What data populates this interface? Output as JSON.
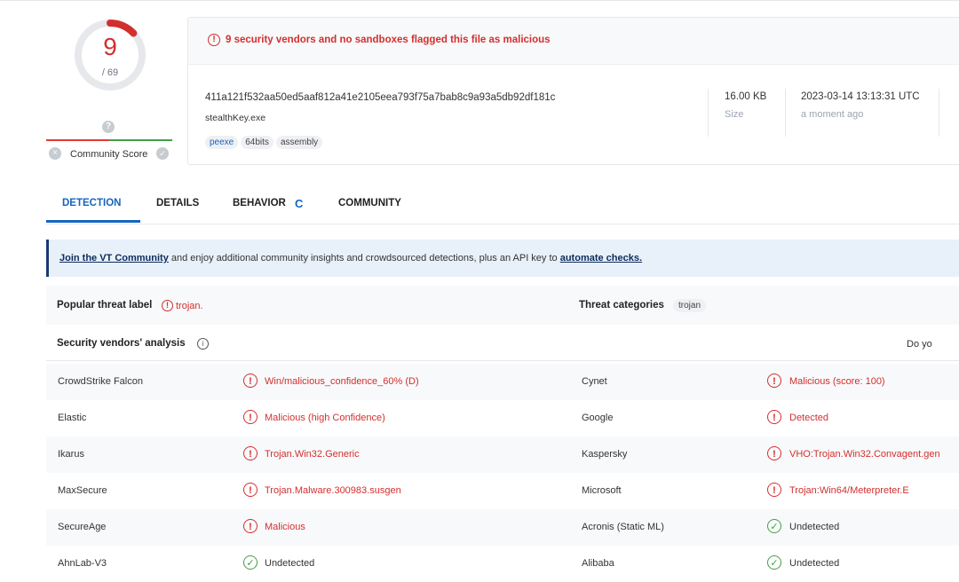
{
  "score": {
    "detections": "9",
    "total": "/ 69"
  },
  "community": {
    "label": "Community Score",
    "question_glyph": "?",
    "x_glyph": "×",
    "check_glyph": "✓"
  },
  "file": {
    "alert": "9 security vendors and no sandboxes flagged this file as malicious",
    "hash": "411a121f532aa50ed5aaf812a41e2105eea793f75a7bab8c9a93a5db92df181c",
    "name": "stealthKey.exe",
    "tags": [
      "peexe",
      "64bits",
      "assembly"
    ],
    "size_value": "16.00 KB",
    "size_label": "Size",
    "date_value": "2023-03-14 13:13:31 UTC",
    "date_label": "a moment ago"
  },
  "tabs": [
    {
      "label": "DETECTION"
    },
    {
      "label": "DETAILS"
    },
    {
      "label": "BEHAVIOR"
    },
    {
      "label": "COMMUNITY"
    }
  ],
  "banner": {
    "link1": "Join the VT Community",
    "middle": " and enjoy additional community insights and crowdsourced detections, plus an API key to ",
    "link2": "automate checks."
  },
  "threat": {
    "popular_label": "Popular threat label",
    "popular_value": "trojan.",
    "categories_label": "Threat categories",
    "category_tag": "trojan"
  },
  "analysis": {
    "title": "Security vendors' analysis",
    "right_text": "Do yo"
  },
  "vendors": [
    {
      "left_name": "CrowdStrike Falcon",
      "left_result": "Win/malicious_confidence_60% (D)",
      "left_status": "malicious",
      "right_name": "Cynet",
      "right_result": "Malicious (score: 100)",
      "right_status": "malicious"
    },
    {
      "left_name": "Elastic",
      "left_result": "Malicious (high Confidence)",
      "left_status": "malicious",
      "right_name": "Google",
      "right_result": "Detected",
      "right_status": "malicious"
    },
    {
      "left_name": "Ikarus",
      "left_result": "Trojan.Win32.Generic",
      "left_status": "malicious",
      "right_name": "Kaspersky",
      "right_result": "VHO:Trojan.Win32.Convagent.gen",
      "right_status": "malicious"
    },
    {
      "left_name": "MaxSecure",
      "left_result": "Trojan.Malware.300983.susgen",
      "left_status": "malicious",
      "right_name": "Microsoft",
      "right_result": "Trojan:Win64/Meterpreter.E",
      "right_status": "malicious"
    },
    {
      "left_name": "SecureAge",
      "left_result": "Malicious",
      "left_status": "malicious",
      "right_name": "Acronis (Static ML)",
      "right_result": "Undetected",
      "right_status": "undetected"
    },
    {
      "left_name": "AhnLab-V3",
      "left_result": "Undetected",
      "left_status": "undetected",
      "right_name": "Alibaba",
      "right_result": "Undetected",
      "right_status": "undetected"
    }
  ],
  "colors": {
    "malicious": "#d32f2f",
    "clean": "#43a047",
    "accent": "#1565c0"
  }
}
